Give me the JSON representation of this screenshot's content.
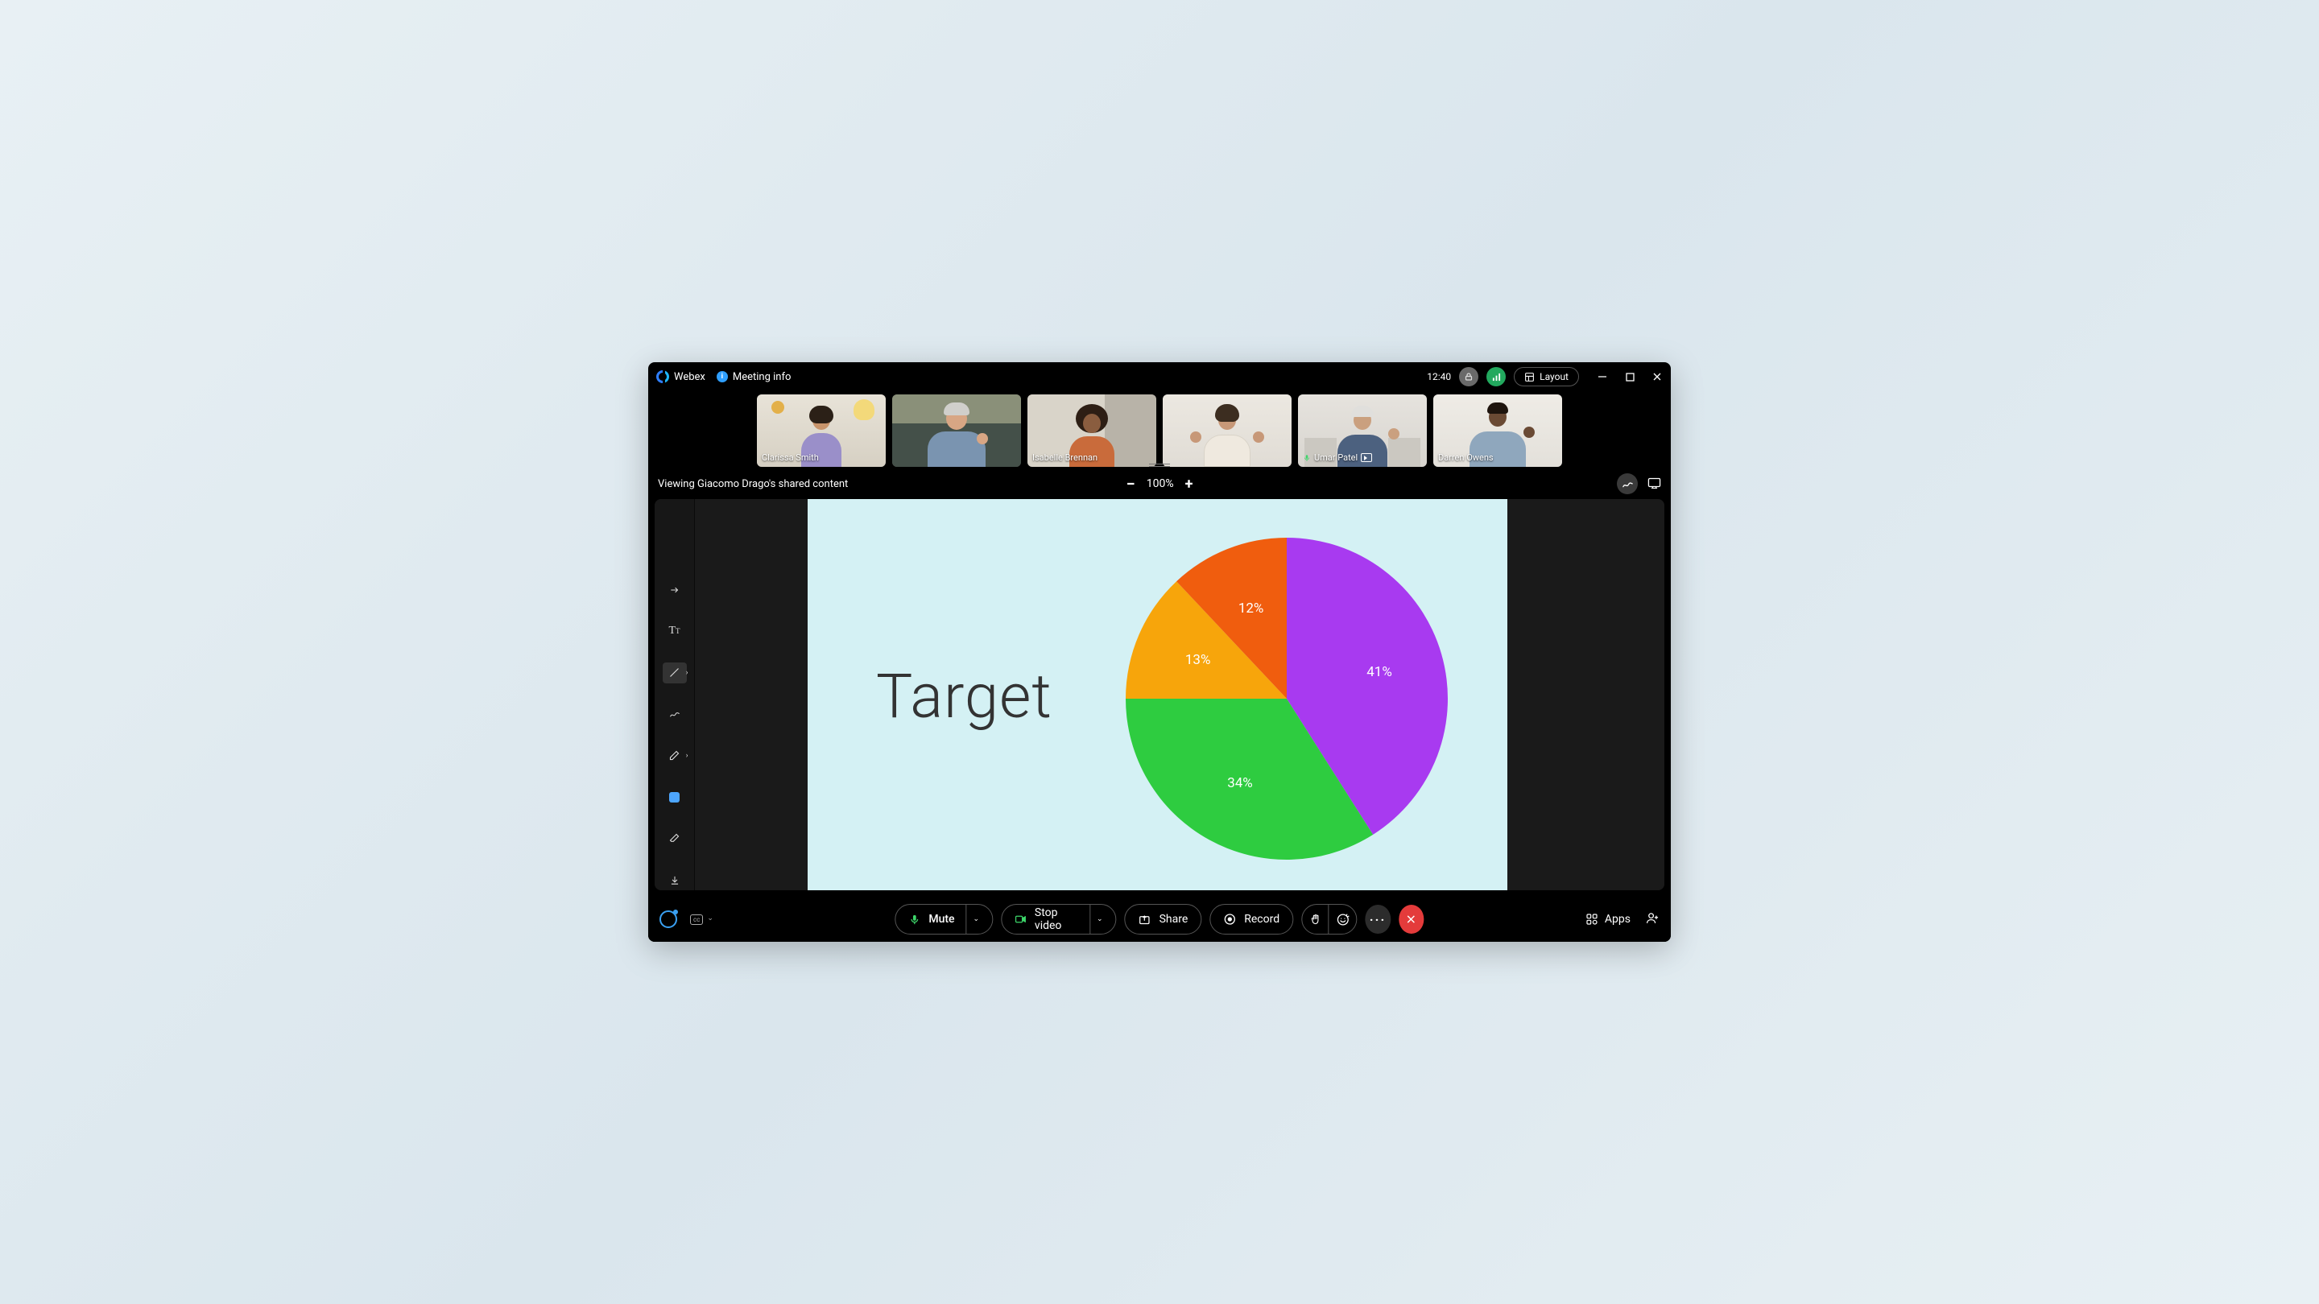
{
  "header": {
    "app_name": "Webex",
    "meeting_info_label": "Meeting info",
    "time": "12:40",
    "layout_label": "Layout"
  },
  "participants": [
    {
      "name": "Clarissa Smith",
      "mic_on": false,
      "pinned": false
    },
    {
      "name": "",
      "mic_on": false,
      "pinned": false
    },
    {
      "name": "Isabelle Brennan",
      "mic_on": false,
      "pinned": false
    },
    {
      "name": "",
      "mic_on": false,
      "pinned": false
    },
    {
      "name": "Umar Patel",
      "mic_on": true,
      "pinned": true
    },
    {
      "name": "Darren Owens",
      "mic_on": false,
      "pinned": false
    }
  ],
  "share": {
    "viewing_text": "Viewing Giacomo Drago's shared content",
    "zoom_level": "100%"
  },
  "slide": {
    "title": "Target"
  },
  "chart_data": {
    "type": "pie",
    "title": "Target",
    "series": [
      {
        "name": "Purple",
        "value": 41,
        "color": "#a83af0",
        "label": "41%"
      },
      {
        "name": "Green",
        "value": 34,
        "color": "#2ecc40",
        "label": "34%"
      },
      {
        "name": "Orange",
        "value": 13,
        "color": "#f7a50b",
        "label": "13%"
      },
      {
        "name": "DarkOrange",
        "value": 12,
        "color": "#f05d0e",
        "label": "12%"
      }
    ]
  },
  "controls": {
    "mute": "Mute",
    "stop_video": "Stop video",
    "share": "Share",
    "record": "Record",
    "apps": "Apps"
  },
  "colors": {
    "slide_bg": "#d4f1f4",
    "leave_red": "#e43b3b"
  }
}
